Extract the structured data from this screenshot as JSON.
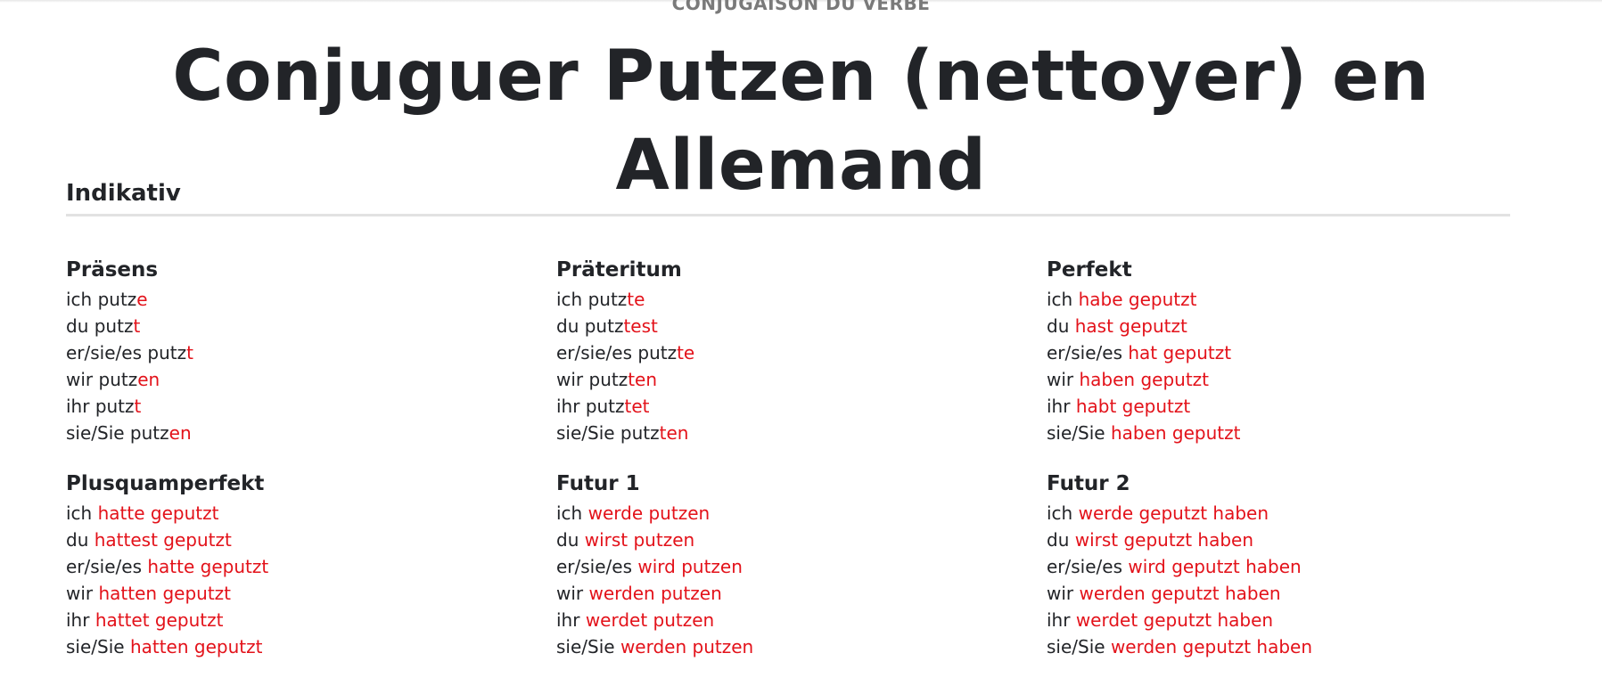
{
  "header": {
    "eyebrow": "CONJUGAISON DU VERBE",
    "title": "Conjuguer Putzen (nettoyer) en Allemand"
  },
  "colors": {
    "ending": "#e3121a",
    "text": "#222428",
    "rule": "#e2e2e2"
  },
  "mood": "Indikativ",
  "tenses": [
    {
      "name": "Präsens",
      "forms": [
        {
          "stem": "ich putz",
          "ending": "e"
        },
        {
          "stem": "du putz",
          "ending": "t"
        },
        {
          "stem": "er/sie/es putz",
          "ending": "t"
        },
        {
          "stem": "wir putz",
          "ending": "en"
        },
        {
          "stem": "ihr putz",
          "ending": "t"
        },
        {
          "stem": "sie/Sie putz",
          "ending": "en"
        }
      ]
    },
    {
      "name": "Präteritum",
      "forms": [
        {
          "stem": "ich putz",
          "ending": "te"
        },
        {
          "stem": "du putz",
          "ending": "test"
        },
        {
          "stem": "er/sie/es putz",
          "ending": "te"
        },
        {
          "stem": "wir putz",
          "ending": "ten"
        },
        {
          "stem": "ihr putz",
          "ending": "tet"
        },
        {
          "stem": "sie/Sie putz",
          "ending": "ten"
        }
      ]
    },
    {
      "name": "Perfekt",
      "forms": [
        {
          "stem": "ich ",
          "ending": "habe geputzt"
        },
        {
          "stem": "du ",
          "ending": "hast geputzt"
        },
        {
          "stem": "er/sie/es ",
          "ending": "hat geputzt"
        },
        {
          "stem": "wir ",
          "ending": "haben geputzt"
        },
        {
          "stem": "ihr ",
          "ending": "habt geputzt"
        },
        {
          "stem": "sie/Sie ",
          "ending": "haben geputzt"
        }
      ]
    },
    {
      "name": "Plusquamperfekt",
      "forms": [
        {
          "stem": "ich ",
          "ending": "hatte geputzt"
        },
        {
          "stem": "du ",
          "ending": "hattest geputzt"
        },
        {
          "stem": "er/sie/es ",
          "ending": "hatte geputzt"
        },
        {
          "stem": "wir ",
          "ending": "hatten geputzt"
        },
        {
          "stem": "ihr ",
          "ending": "hattet geputzt"
        },
        {
          "stem": "sie/Sie ",
          "ending": "hatten geputzt"
        }
      ]
    },
    {
      "name": "Futur 1",
      "forms": [
        {
          "stem": "ich ",
          "ending": "werde putzen"
        },
        {
          "stem": "du ",
          "ending": "wirst putzen"
        },
        {
          "stem": "er/sie/es ",
          "ending": "wird putzen"
        },
        {
          "stem": "wir ",
          "ending": "werden putzen"
        },
        {
          "stem": "ihr ",
          "ending": "werdet putzen"
        },
        {
          "stem": "sie/Sie ",
          "ending": "werden putzen"
        }
      ]
    },
    {
      "name": "Futur 2",
      "forms": [
        {
          "stem": "ich ",
          "ending": "werde geputzt haben"
        },
        {
          "stem": "du ",
          "ending": "wirst geputzt haben"
        },
        {
          "stem": "er/sie/es ",
          "ending": "wird geputzt haben"
        },
        {
          "stem": "wir ",
          "ending": "werden geputzt haben"
        },
        {
          "stem": "ihr ",
          "ending": "werdet geputzt haben"
        },
        {
          "stem": "sie/Sie ",
          "ending": "werden geputzt haben"
        }
      ]
    }
  ]
}
